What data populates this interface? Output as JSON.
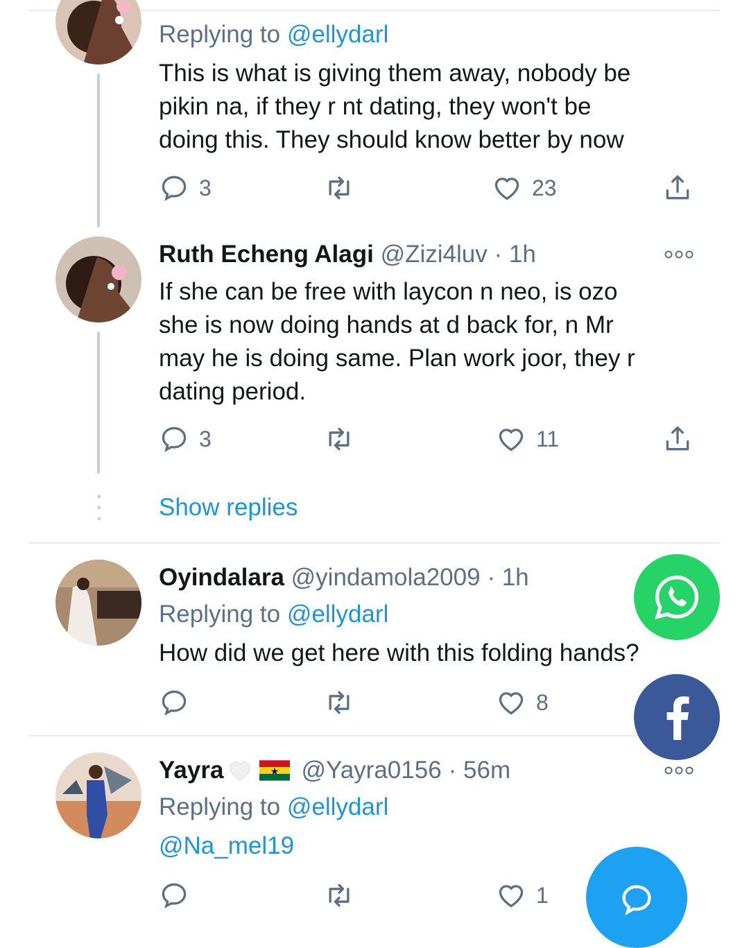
{
  "tweets": [
    {
      "replying_label": "Replying to",
      "replying_handle": "@ellydarl",
      "lines": [
        "This is what is giving them away, nobody be",
        "pikin na, if they r nt dating, they won't be",
        "doing this. They should know better by now"
      ],
      "replies": "3",
      "retweets": "",
      "likes": "23"
    },
    {
      "name": "Ruth Echeng Alagi",
      "handle": "@Zizi4luv",
      "time": "· 1h",
      "lines": [
        "If she can be free with laycon n neo, is ozo",
        "she is now doing hands at d back for, n Mr",
        "may he is doing same. Plan work joor, they r",
        "dating period."
      ],
      "replies": "3",
      "retweets": "",
      "likes": "11"
    },
    {
      "name": "Oyindalara",
      "handle": "@yindamola2009",
      "time": "· 1h",
      "replying_label": "Replying to",
      "replying_handle": "@ellydarl",
      "lines": [
        "How did we get here with this folding hands?"
      ],
      "replies": "",
      "retweets": "",
      "likes": "8"
    },
    {
      "name": "Yayra",
      "handle": "@Yayra0156",
      "time": "· 56m",
      "replying_label": "Replying to",
      "replying_handle": "@ellydarl",
      "lines": [
        "@Na_mel19"
      ],
      "replies": "",
      "retweets": "",
      "likes": "1"
    }
  ],
  "show_replies_label": "Show replies",
  "icons": {
    "reply": "reply-icon",
    "retweet": "retweet-icon",
    "like": "heart-icon",
    "share": "share-icon",
    "more": "more-icon",
    "whatsapp": "whatsapp-icon",
    "facebook": "facebook-icon",
    "compose": "compose-reply-icon"
  },
  "colors": {
    "link": "#1b95e0",
    "whatsapp": "#25d366",
    "facebook": "#3b5998",
    "fab": "#1da1f2",
    "secondary_text": "#5b7083"
  }
}
